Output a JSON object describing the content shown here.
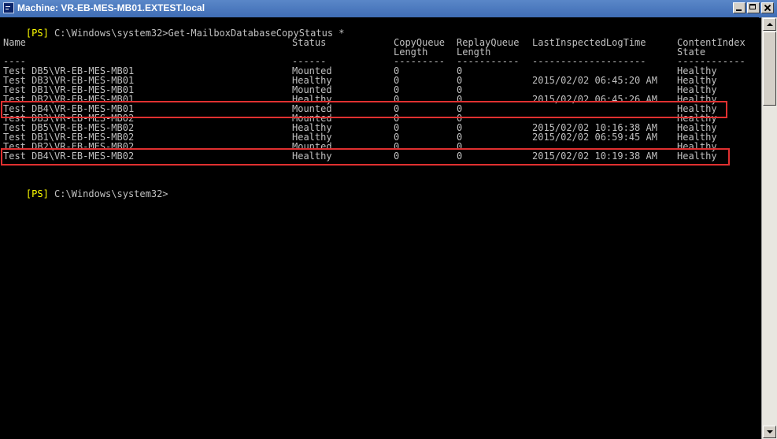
{
  "window": {
    "title": "Machine: VR-EB-MES-MB01.EXTEST.local",
    "icon": "console-icon"
  },
  "console": {
    "prompt_tag": "[PS]",
    "prompt_path": " C:\\Windows\\system32>",
    "command": "Get-MailboxDatabaseCopyStatus *",
    "headers": {
      "line1": [
        "Name",
        "Status",
        "CopyQueue",
        "ReplayQueue",
        "LastInspectedLogTime",
        "ContentIndex"
      ],
      "line2": [
        "",
        "",
        "Length",
        "Length",
        "",
        "State"
      ],
      "underline": [
        "----",
        "------",
        "---------",
        "-----------",
        "--------------------",
        "------------"
      ]
    },
    "rows": [
      [
        "Test DB5\\VR-EB-MES-MB01",
        "Mounted",
        "0",
        "0",
        "",
        "Healthy"
      ],
      [
        "Test DB3\\VR-EB-MES-MB01",
        "Healthy",
        "0",
        "0",
        "2015/02/02 06:45:20 AM",
        "Healthy"
      ],
      [
        "Test DB1\\VR-EB-MES-MB01",
        "Mounted",
        "0",
        "0",
        "",
        "Healthy"
      ],
      [
        "Test DB2\\VR-EB-MES-MB01",
        "Healthy",
        "0",
        "0",
        "2015/02/02 06:45:26 AM",
        "Healthy"
      ],
      [
        "Test DB4\\VR-EB-MES-MB01",
        "Mounted",
        "0",
        "0",
        "",
        "Healthy"
      ],
      [
        "Test DB3\\VR-EB-MES-MB02",
        "Mounted",
        "0",
        "0",
        "",
        "Healthy"
      ],
      [
        "Test DB5\\VR-EB-MES-MB02",
        "Healthy",
        "0",
        "0",
        "2015/02/02 10:16:38 AM",
        "Healthy"
      ],
      [
        "Test DB1\\VR-EB-MES-MB02",
        "Healthy",
        "0",
        "0",
        "2015/02/02 06:59:45 AM",
        "Healthy"
      ],
      [
        "Test DB2\\VR-EB-MES-MB02",
        "Mounted",
        "0",
        "0",
        "",
        "Healthy"
      ],
      [
        "Test DB4\\VR-EB-MES-MB02",
        "Healthy",
        "0",
        "0",
        "2015/02/02 10:19:38 AM",
        "Healthy"
      ]
    ],
    "highlighted_rows": [
      4,
      9
    ],
    "final_prompt_tag": "[PS]",
    "final_prompt_path": " C:\\Windows\\system32>"
  },
  "colors": {
    "background": "#000000",
    "text": "#c0c0c0",
    "prompt_tag": "#ffff00",
    "highlight": "#e03030"
  }
}
